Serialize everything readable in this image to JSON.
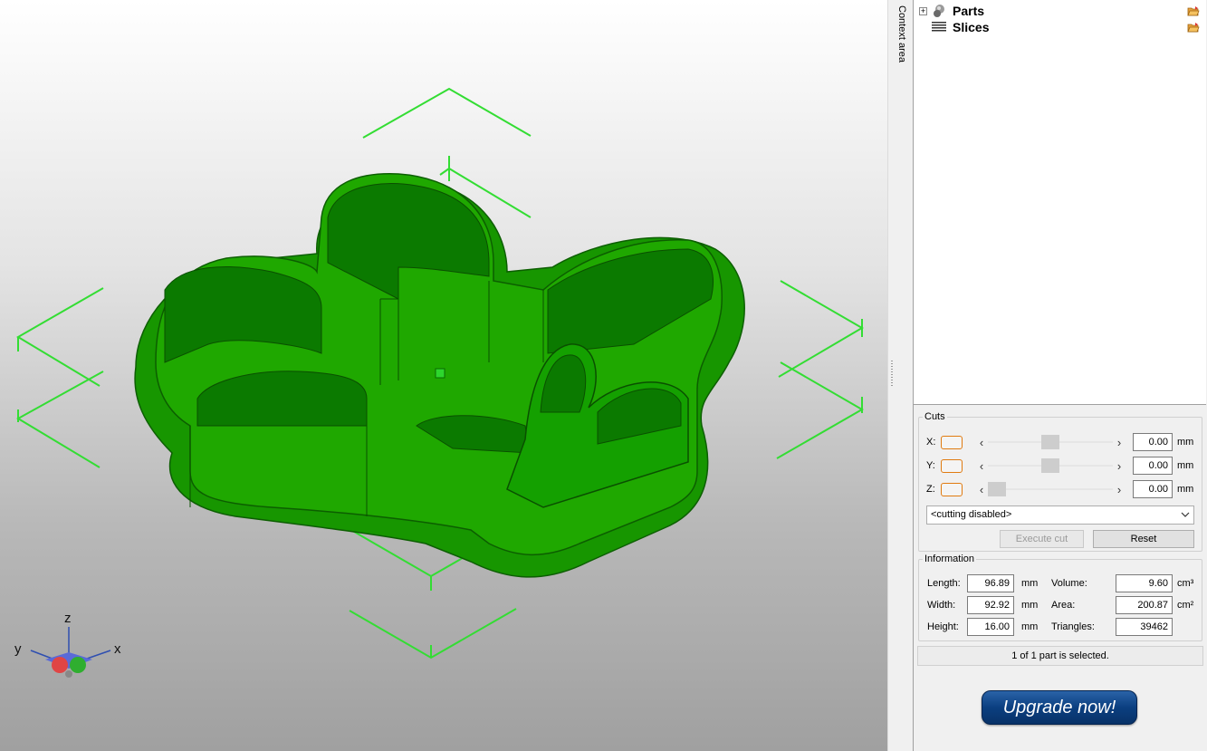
{
  "viewport": {
    "axis_labels": {
      "z": "z",
      "y": "y",
      "x": "x"
    },
    "model_color": "#1f9d00",
    "bbox_color": "#33dd33"
  },
  "context_strip": {
    "label": "Context area"
  },
  "tree": {
    "items": [
      {
        "label": "Parts",
        "icon": "parts-icon",
        "expander": "+"
      },
      {
        "label": "Slices",
        "icon": "slices-icon"
      }
    ]
  },
  "cuts": {
    "title": "Cuts",
    "rows": [
      {
        "axis": "X:",
        "value": "0.00",
        "unit": "mm",
        "slider_fraction": 0.5
      },
      {
        "axis": "Y:",
        "value": "0.00",
        "unit": "mm",
        "slider_fraction": 0.5
      },
      {
        "axis": "Z:",
        "value": "0.00",
        "unit": "mm",
        "slider_fraction": 0.0
      }
    ],
    "mode_select": "<cutting disabled>",
    "execute_label": "Execute cut",
    "reset_label": "Reset"
  },
  "information": {
    "title": "Information",
    "length_label": "Length:",
    "length_value": "96.89",
    "length_unit": "mm",
    "width_label": "Width:",
    "width_value": "92.92",
    "width_unit": "mm",
    "height_label": "Height:",
    "height_value": "16.00",
    "height_unit": "mm",
    "volume_label": "Volume:",
    "volume_value": "9.60",
    "volume_unit": "cm³",
    "area_label": "Area:",
    "area_value": "200.87",
    "area_unit": "cm²",
    "triangles_label": "Triangles:",
    "triangles_value": "39462"
  },
  "status": "1 of 1 part is selected.",
  "upgrade_label": "Upgrade now!"
}
